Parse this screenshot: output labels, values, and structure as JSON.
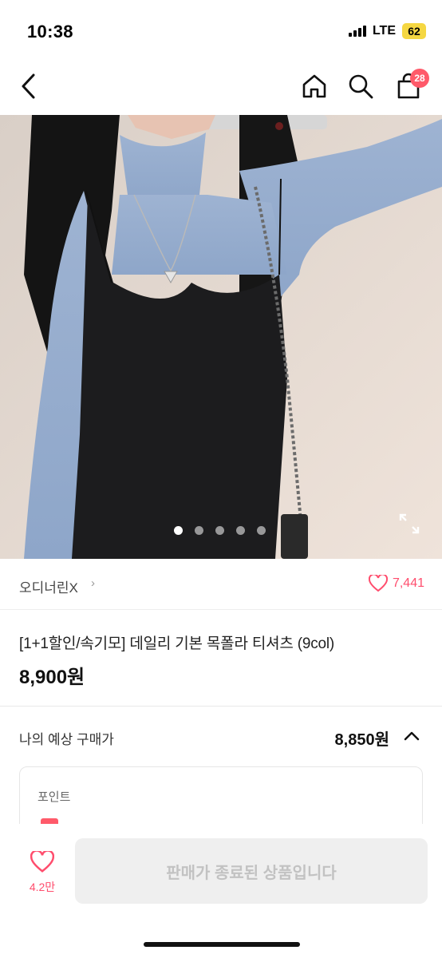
{
  "status_bar": {
    "time": "10:38",
    "network": "LTE",
    "battery": "62"
  },
  "nav": {
    "icons": [
      "back-icon",
      "home-icon",
      "search-icon",
      "shopping-bag-icon"
    ],
    "cart_badge": "28"
  },
  "gallery": {
    "image_count": 5,
    "active_index": 0
  },
  "brand": {
    "name": "오디너린X",
    "chevron": "›",
    "likes": "7,441"
  },
  "product": {
    "title": "[1+1할인/속기모] 데일리 기본 목폴라 티셔츠 (9col)",
    "price": "8,900원"
  },
  "expected_price": {
    "label": "나의 예상 구매가",
    "value": "8,850원"
  },
  "points": {
    "title": "포인트"
  },
  "bottom_bar": {
    "wish_count": "4.2만",
    "sold_out_label": "판매가 종료된 상품입니다"
  },
  "colors": {
    "accent": "#ff4d6d",
    "badge": "#ff5a6a",
    "battery": "#f5d742",
    "disabled_button_bg": "#efefef",
    "disabled_button_text": "#c2c2c2"
  }
}
